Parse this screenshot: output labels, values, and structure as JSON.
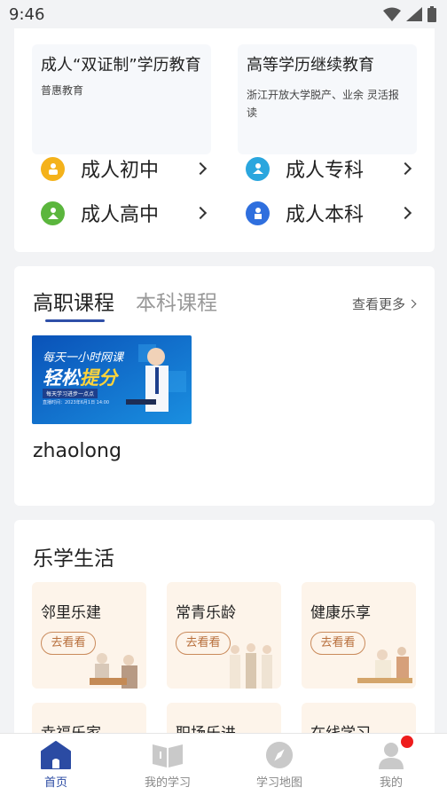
{
  "status_bar": {
    "time": "9:46"
  },
  "education": {
    "left_box": {
      "title": "成人“双证制”学历教育",
      "subtitle": "普惠教育"
    },
    "right_box": {
      "title": "高等学历继续教育",
      "subtitle": "浙江开放大学脱产、业余 灵活报读"
    },
    "items": [
      {
        "label": "成人初中",
        "icon": "junior-school-icon",
        "color": "#f4b21b"
      },
      {
        "label": "成人专科",
        "icon": "college-icon",
        "color": "#2aa6de"
      },
      {
        "label": "成人高中",
        "icon": "senior-school-icon",
        "color": "#5bb63d"
      },
      {
        "label": "成人本科",
        "icon": "bachelor-icon",
        "color": "#2f6fde"
      }
    ]
  },
  "courses": {
    "tabs": [
      {
        "label": "高职课程"
      },
      {
        "label": "本科课程"
      }
    ],
    "more_label": "查看更多",
    "thumbnail": {
      "line1": "每天一小时网课",
      "line2": "轻松",
      "line2b": "提分",
      "tag": "每天学习进步一点点",
      "date": "直播时间：2023年6月1日 14:00"
    },
    "course_name": "zhaolong"
  },
  "life": {
    "title": "乐学生活",
    "tiles": [
      {
        "name": "邻里乐建",
        "button": "去看看"
      },
      {
        "name": "常青乐龄",
        "button": "去看看"
      },
      {
        "name": "健康乐享",
        "button": "去看看"
      },
      {
        "name": "幸福乐家"
      },
      {
        "name": "职场乐进"
      },
      {
        "name": "在线学习"
      }
    ]
  },
  "bottom_nav": [
    {
      "label": "首页",
      "icon": "home-icon",
      "active": true
    },
    {
      "label": "我的学习",
      "icon": "book-icon"
    },
    {
      "label": "学习地图",
      "icon": "compass-icon"
    },
    {
      "label": "我的",
      "icon": "user-icon"
    }
  ],
  "colors": {
    "accent": "#2b4ba3",
    "badge": "#ee1c1c",
    "tile_bg": "#fdf4ea",
    "tile_button": "#c98a5b"
  }
}
